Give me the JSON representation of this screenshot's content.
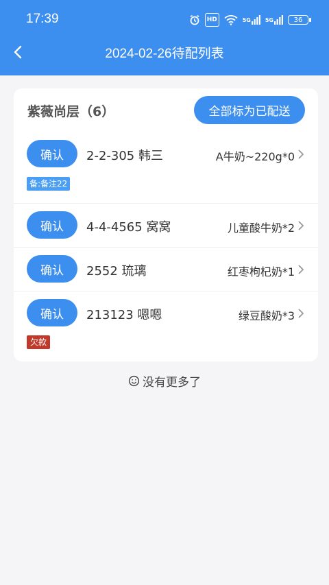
{
  "status_bar": {
    "time": "17:39",
    "hd": "HD",
    "net1": "5G",
    "net2": "5G",
    "battery": "36"
  },
  "header": {
    "title": "2024-02-26待配列表"
  },
  "group": {
    "title": "紫薇尚层（6）",
    "mark_all_label": "全部标为已配送",
    "orders": [
      {
        "confirm_label": "确认",
        "address": "2-2-305 韩三",
        "product": "A牛奶~220g*0",
        "tag": "备:备注22",
        "tag_type": "note"
      },
      {
        "confirm_label": "确认",
        "address": "4-4-4565 窝窝",
        "product": "儿童酸牛奶*2"
      },
      {
        "confirm_label": "确认",
        "address": "2552 琉璃",
        "product": "红枣枸杞奶*1"
      },
      {
        "confirm_label": "确认",
        "address": "213123 嗯嗯",
        "product": "绿豆酸奶*3",
        "tag": "欠款",
        "tag_type": "debt"
      }
    ]
  },
  "footer": {
    "no_more": "没有更多了"
  },
  "colors": {
    "primary": "#3d8fef",
    "debt": "#c0392b",
    "note": "#4a9ef3"
  }
}
